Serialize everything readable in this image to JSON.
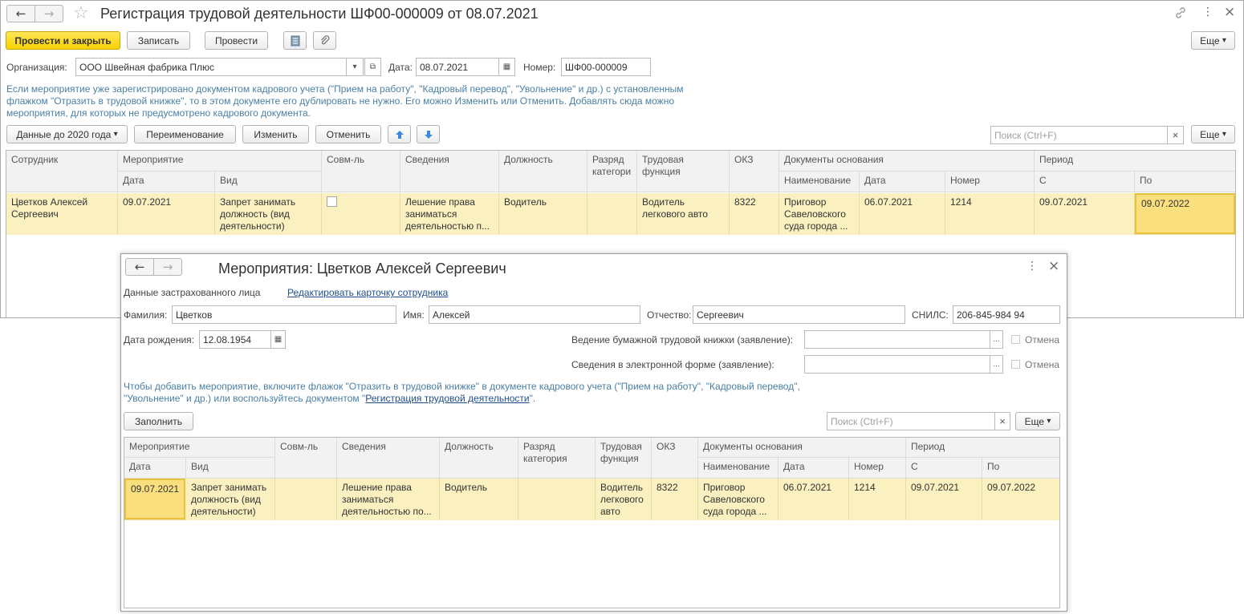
{
  "main": {
    "title": "Регистрация трудовой деятельности ШФ00-000009 от 08.07.2021",
    "toolbar": {
      "post_close": "Провести и закрыть",
      "save": "Записать",
      "post": "Провести",
      "more": "Еще"
    },
    "org_label": "Организация:",
    "org_value": "ООО Швейная фабрика Плюс",
    "date_label": "Дата:",
    "date_value": "08.07.2021",
    "number_label": "Номер:",
    "number_value": "ШФ00-000009",
    "info_lines": [
      "Если мероприятие уже зарегистрировано документом кадрового учета (\"Прием на работу\", \"Кадровый перевод\", \"Увольнение\" и др.) с установленным",
      "флажком \"Отразить в трудовой книжке\", то в этом документе его дублировать не нужно. Его можно Изменить или Отменить. Добавлять сюда можно",
      "мероприятия, для которых не предусмотрено кадрового документа."
    ],
    "cmd": {
      "data2020": "Данные до 2020 года",
      "rename": "Переименование",
      "change": "Изменить",
      "cancel": "Отменить",
      "search_placeholder": "Поиск (Ctrl+F)",
      "more": "Еще"
    },
    "table": {
      "headers": {
        "employee": "Сотрудник",
        "event": "Мероприятие",
        "date": "Дата",
        "kind": "Вид",
        "parttime": "Совм-ль",
        "info": "Сведения",
        "position": "Должность",
        "grade": "Разряд категори",
        "function": "Трудовая функция",
        "okz": "ОКЗ",
        "docs": "Документы основания",
        "doc_name": "Наименование",
        "doc_date": "Дата",
        "doc_number": "Номер",
        "period": "Период",
        "from": "С",
        "to": "По"
      },
      "row": {
        "employee": "Цветков Алексей Сергеевич",
        "date": "09.07.2021",
        "kind": "Запрет занимать должность (вид деятельности)",
        "info": "Лешение права заниматься деятельностью п...",
        "position": "Водитель",
        "grade": "",
        "function": "Водитель легкового авто",
        "okz": "8322",
        "doc_name": "Приговор Савеловского суда города ...",
        "doc_date": "06.07.2021",
        "doc_number": "1214",
        "from": "09.07.2021",
        "to": "09.07.2022"
      }
    }
  },
  "dialog": {
    "title": "Мероприятия: Цветков Алексей Сергеевич",
    "insured_label": "Данные застрахованного лица",
    "edit_link": "Редактировать карточку сотрудника",
    "surname_label": "Фамилия:",
    "surname_value": "Цветков",
    "name_label": "Имя:",
    "name_value": "Алексей",
    "patronymic_label": "Отчество:",
    "patronymic_value": "Сергеевич",
    "snils_label": "СНИЛС:",
    "snils_value": "206-845-984 94",
    "birth_label": "Дата рождения:",
    "birth_value": "12.08.1954",
    "paper_label": "Ведение бумажной трудовой книжки (заявление):",
    "electronic_label": "Сведения в электронной форме (заявление):",
    "cancel_label": "Отмена",
    "info_1": "Чтобы добавить мероприятие, включите флажок \"Отразить в трудовой книжке\" в документе кадрового учета (\"Прием на работу\", \"Кадровый перевод\",",
    "info_2a": "\"Увольнение\" и др.) или воспользуйтесь документом \"",
    "info_2_link": "Регистрация трудовой деятельности",
    "info_2b": "\".",
    "fill": "Заполнить",
    "search_placeholder": "Поиск (Ctrl+F)",
    "more": "Еще",
    "table": {
      "headers": {
        "event": "Мероприятие",
        "date": "Дата",
        "kind": "Вид",
        "parttime": "Совм-ль",
        "info": "Сведения",
        "position": "Должность",
        "grade": "Разряд категория",
        "function": "Трудовая функция",
        "okz": "ОКЗ",
        "docs": "Документы основания",
        "doc_name": "Наименование",
        "doc_date": "Дата",
        "doc_number": "Номер",
        "period": "Период",
        "from": "С",
        "to": "По"
      },
      "row": {
        "date": "09.07.2021",
        "kind": "Запрет занимать должность (вид деятельности)",
        "info": "Лешение права заниматься деятельностью по...",
        "position": "Водитель",
        "grade": "",
        "function": "Водитель легкового авто",
        "okz": "8322",
        "doc_name": "Приговор Савеловского суда города ...",
        "doc_date": "06.07.2021",
        "doc_number": "1214",
        "from": "09.07.2021",
        "to": "09.07.2022"
      }
    }
  },
  "icons": {
    "back": "←",
    "forward": "→",
    "star": "☆",
    "link": "🔗",
    "kebab": "⋮",
    "close": "×",
    "dropdown": "▾",
    "open": "⧉",
    "calendar": "▦",
    "up": "🡅",
    "down": "🡇",
    "clear": "×",
    "ellipsis": "..."
  },
  "colors": {
    "accent_yellow": "#f7d200",
    "selected_row": "#fbf0c0",
    "info_text": "#4a7fa5",
    "link": "#1f4e8c"
  }
}
